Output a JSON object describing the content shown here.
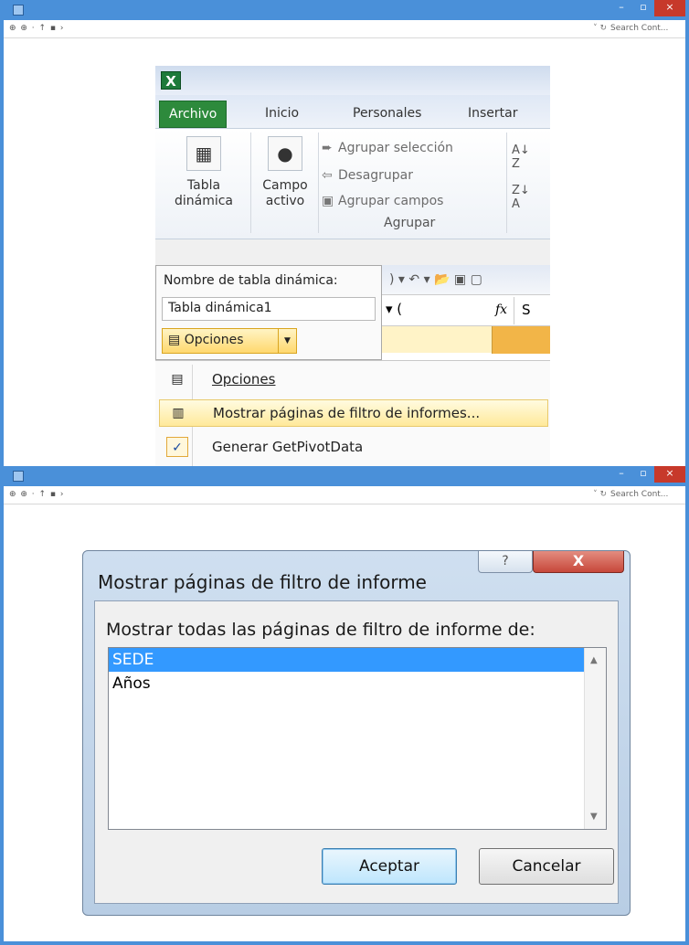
{
  "top_window": {
    "address_search": "Search Cont...",
    "excel": {
      "logo": "X",
      "tabs": [
        "Archivo",
        "Inicio",
        "Personales",
        "Insertar"
      ],
      "ribbon": {
        "tabla_dinamica": "Tabla\ndinámica",
        "campo_activo": "Campo\nactivo",
        "agrupar_seleccion": "Agrupar selección",
        "desagrupar": "Desagrupar",
        "agrupar_campos": "Agrupar campos",
        "group_label": "Agrupar"
      },
      "pivot_name_label": "Nombre de tabla dinámica:",
      "pivot_name_value": "Tabla dinámica1",
      "options_button": "Opciones",
      "formula_fx": "fx",
      "formula_cell": "S",
      "menu": {
        "item1": "Opciones",
        "item2": "Mostrar páginas de filtro de informes...",
        "item3": "Generar GetPivotData"
      }
    }
  },
  "bottom_window": {
    "address_search": "Search Cont...",
    "dialog": {
      "title": "Mostrar páginas de filtro de informe",
      "help": "?",
      "close": "X",
      "label": "Mostrar todas las páginas de filtro de informe de:",
      "items": [
        "SEDE",
        "Años"
      ],
      "selected_item": "SEDE",
      "ok": "Aceptar",
      "cancel": "Cancelar"
    }
  }
}
